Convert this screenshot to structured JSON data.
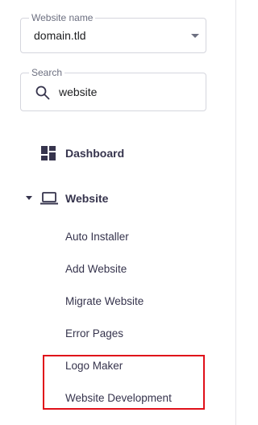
{
  "website_select": {
    "label": "Website name",
    "value": "domain.tld"
  },
  "search": {
    "label": "Search",
    "value": "website"
  },
  "nav": {
    "dashboard": "Dashboard",
    "website": "Website",
    "website_sub": [
      "Auto Installer",
      "Add Website",
      "Migrate Website",
      "Error Pages",
      "Logo Maker",
      "Website Development"
    ]
  },
  "colors": {
    "highlight": "#e0101a",
    "text": "#36344d"
  }
}
